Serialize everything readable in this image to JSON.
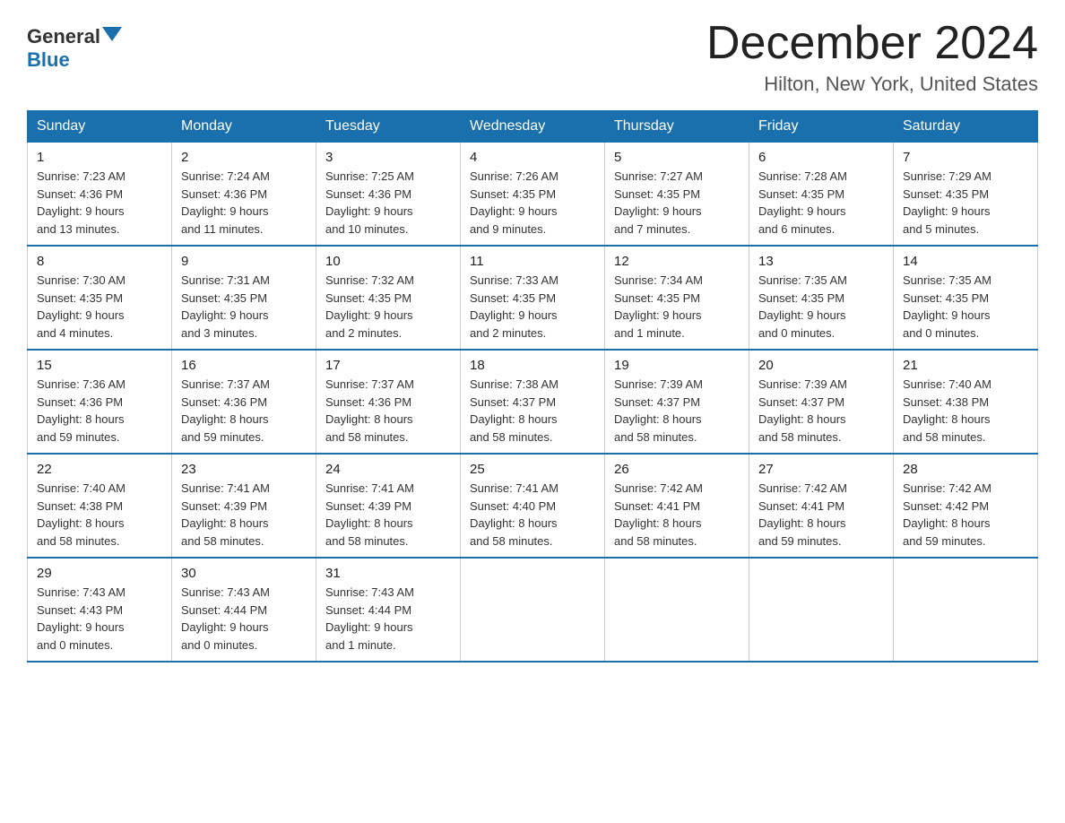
{
  "logo": {
    "general": "General",
    "blue": "Blue"
  },
  "title": "December 2024",
  "location": "Hilton, New York, United States",
  "days_of_week": [
    "Sunday",
    "Monday",
    "Tuesday",
    "Wednesday",
    "Thursday",
    "Friday",
    "Saturday"
  ],
  "weeks": [
    [
      {
        "day": "1",
        "sunrise": "7:23 AM",
        "sunset": "4:36 PM",
        "daylight": "9 hours and 13 minutes."
      },
      {
        "day": "2",
        "sunrise": "7:24 AM",
        "sunset": "4:36 PM",
        "daylight": "9 hours and 11 minutes."
      },
      {
        "day": "3",
        "sunrise": "7:25 AM",
        "sunset": "4:36 PM",
        "daylight": "9 hours and 10 minutes."
      },
      {
        "day": "4",
        "sunrise": "7:26 AM",
        "sunset": "4:35 PM",
        "daylight": "9 hours and 9 minutes."
      },
      {
        "day": "5",
        "sunrise": "7:27 AM",
        "sunset": "4:35 PM",
        "daylight": "9 hours and 7 minutes."
      },
      {
        "day": "6",
        "sunrise": "7:28 AM",
        "sunset": "4:35 PM",
        "daylight": "9 hours and 6 minutes."
      },
      {
        "day": "7",
        "sunrise": "7:29 AM",
        "sunset": "4:35 PM",
        "daylight": "9 hours and 5 minutes."
      }
    ],
    [
      {
        "day": "8",
        "sunrise": "7:30 AM",
        "sunset": "4:35 PM",
        "daylight": "9 hours and 4 minutes."
      },
      {
        "day": "9",
        "sunrise": "7:31 AM",
        "sunset": "4:35 PM",
        "daylight": "9 hours and 3 minutes."
      },
      {
        "day": "10",
        "sunrise": "7:32 AM",
        "sunset": "4:35 PM",
        "daylight": "9 hours and 2 minutes."
      },
      {
        "day": "11",
        "sunrise": "7:33 AM",
        "sunset": "4:35 PM",
        "daylight": "9 hours and 2 minutes."
      },
      {
        "day": "12",
        "sunrise": "7:34 AM",
        "sunset": "4:35 PM",
        "daylight": "9 hours and 1 minute."
      },
      {
        "day": "13",
        "sunrise": "7:35 AM",
        "sunset": "4:35 PM",
        "daylight": "9 hours and 0 minutes."
      },
      {
        "day": "14",
        "sunrise": "7:35 AM",
        "sunset": "4:35 PM",
        "daylight": "9 hours and 0 minutes."
      }
    ],
    [
      {
        "day": "15",
        "sunrise": "7:36 AM",
        "sunset": "4:36 PM",
        "daylight": "8 hours and 59 minutes."
      },
      {
        "day": "16",
        "sunrise": "7:37 AM",
        "sunset": "4:36 PM",
        "daylight": "8 hours and 59 minutes."
      },
      {
        "day": "17",
        "sunrise": "7:37 AM",
        "sunset": "4:36 PM",
        "daylight": "8 hours and 58 minutes."
      },
      {
        "day": "18",
        "sunrise": "7:38 AM",
        "sunset": "4:37 PM",
        "daylight": "8 hours and 58 minutes."
      },
      {
        "day": "19",
        "sunrise": "7:39 AM",
        "sunset": "4:37 PM",
        "daylight": "8 hours and 58 minutes."
      },
      {
        "day": "20",
        "sunrise": "7:39 AM",
        "sunset": "4:37 PM",
        "daylight": "8 hours and 58 minutes."
      },
      {
        "day": "21",
        "sunrise": "7:40 AM",
        "sunset": "4:38 PM",
        "daylight": "8 hours and 58 minutes."
      }
    ],
    [
      {
        "day": "22",
        "sunrise": "7:40 AM",
        "sunset": "4:38 PM",
        "daylight": "8 hours and 58 minutes."
      },
      {
        "day": "23",
        "sunrise": "7:41 AM",
        "sunset": "4:39 PM",
        "daylight": "8 hours and 58 minutes."
      },
      {
        "day": "24",
        "sunrise": "7:41 AM",
        "sunset": "4:39 PM",
        "daylight": "8 hours and 58 minutes."
      },
      {
        "day": "25",
        "sunrise": "7:41 AM",
        "sunset": "4:40 PM",
        "daylight": "8 hours and 58 minutes."
      },
      {
        "day": "26",
        "sunrise": "7:42 AM",
        "sunset": "4:41 PM",
        "daylight": "8 hours and 58 minutes."
      },
      {
        "day": "27",
        "sunrise": "7:42 AM",
        "sunset": "4:41 PM",
        "daylight": "8 hours and 59 minutes."
      },
      {
        "day": "28",
        "sunrise": "7:42 AM",
        "sunset": "4:42 PM",
        "daylight": "8 hours and 59 minutes."
      }
    ],
    [
      {
        "day": "29",
        "sunrise": "7:43 AM",
        "sunset": "4:43 PM",
        "daylight": "9 hours and 0 minutes."
      },
      {
        "day": "30",
        "sunrise": "7:43 AM",
        "sunset": "4:44 PM",
        "daylight": "9 hours and 0 minutes."
      },
      {
        "day": "31",
        "sunrise": "7:43 AM",
        "sunset": "4:44 PM",
        "daylight": "9 hours and 1 minute."
      },
      null,
      null,
      null,
      null
    ]
  ],
  "labels": {
    "sunrise": "Sunrise:",
    "sunset": "Sunset:",
    "daylight": "Daylight:"
  }
}
